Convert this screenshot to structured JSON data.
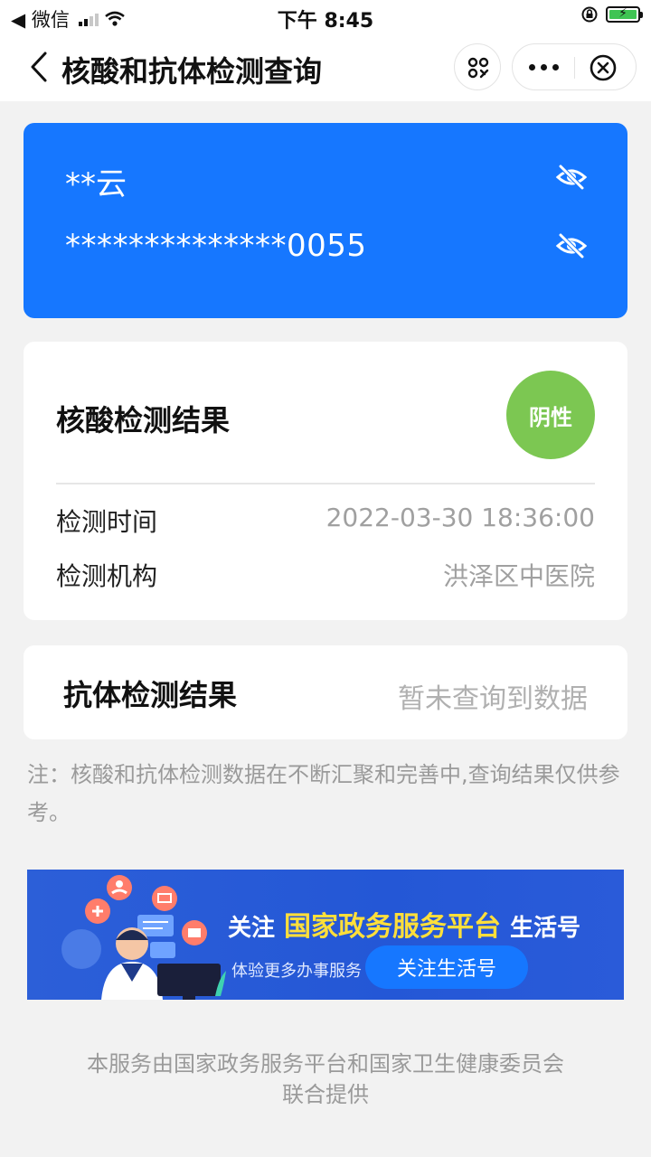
{
  "status_bar": {
    "back_app": "◀ 微信",
    "time": "下午 8:45"
  },
  "nav": {
    "title": "核酸和抗体检测查询"
  },
  "id_card": {
    "name": "**云",
    "id_number": "**************0055"
  },
  "nucleic": {
    "title": "核酸检测结果",
    "result": "阴性",
    "rows": [
      {
        "label": "检测时间",
        "value": "2022-03-30 18:36:00"
      },
      {
        "label": "检测机构",
        "value": "洪泽区中医院"
      }
    ]
  },
  "antibody": {
    "title": "抗体检测结果",
    "value": "暂未查询到数据"
  },
  "note": "注：核酸和抗体检测数据在不断汇聚和完善中,查询结果仅供参考。",
  "banner": {
    "pre": "关注",
    "highlight": "国家政务服务平台",
    "post": "生活号",
    "sub": "体验更多办事服务",
    "button": "关注生活号"
  },
  "footer": {
    "line1": "本服务由国家政务服务平台和国家卫生健康委员会",
    "line2": "联合提供"
  },
  "colors": {
    "primary": "#1677ff",
    "negative_green": "#7cc752",
    "background": "#f2f2f2",
    "banner_highlight": "#ffdf3a"
  }
}
